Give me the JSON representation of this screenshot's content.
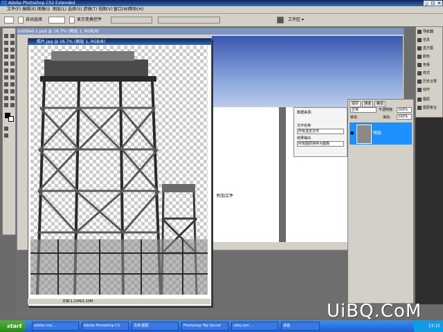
{
  "app": {
    "title": "Adobe Photoshop CS2 Extended"
  },
  "menu": {
    "items": [
      "文件(F)",
      "编辑(E)",
      "图像(I)",
      "图层(L)",
      "选择(S)",
      "滤镜(T)",
      "视图(V)",
      "窗口(W)",
      "帮助(H)"
    ]
  },
  "options": {
    "auto_select": "自动选择",
    "show_bounds": "显示变换控件",
    "workspace": "工作区 ▾"
  },
  "back_document": {
    "title": "Untitled-1.psd @ 16.7% (图层 1, RGB/8)"
  },
  "main_document": {
    "title": "照片.jpg @ 16.7% (图层 1, RGB/8)",
    "status": "文档:1.23M/1.23M"
  },
  "info_panel": {
    "label_source": "数据来源:",
    "label_file": "文件名称",
    "label_option": "选项设置",
    "value_selected": "所有选定文件",
    "label_output": "结果输出",
    "value_output": "所有图层保存为图像",
    "footer_text": "附加文件"
  },
  "layers_panel": {
    "tabs": [
      "图层",
      "通道",
      "路径"
    ],
    "blend_mode": "正常",
    "opacity_label": "不透明度:",
    "opacity_value": "100%",
    "lock_label": "锁定:",
    "fill_label": "填充:",
    "fill_value": "100%",
    "layer_name": "图层"
  },
  "right_panels": {
    "items": [
      "导航器",
      "信息",
      "直方图",
      "颜色",
      "色板",
      "样式",
      "历史记录",
      "动作",
      "图层",
      "图层复合"
    ]
  },
  "taskbar": {
    "start_label": "start",
    "tasks": [
      "adobe mio...",
      "Adobe Photoshop CS",
      "文档-图层",
      "Photoshop Top Secret",
      "uibq.com ...",
      "桌面"
    ],
    "clock": "13:15"
  },
  "watermark": "UiBQ.CoM"
}
